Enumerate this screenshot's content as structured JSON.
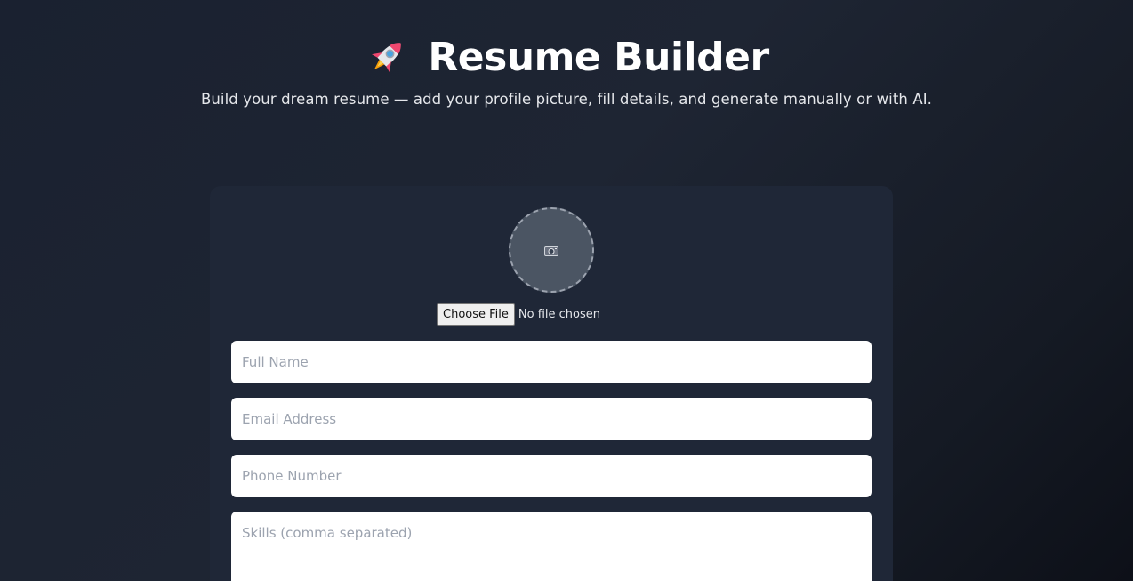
{
  "header": {
    "icon": "rocket-icon",
    "title": "Resume Builder",
    "subtitle": "Build your dream resume — add your profile picture, fill details, and generate manually or with AI."
  },
  "profile": {
    "avatar_icon": "camera-icon",
    "file_button_label": "Choose File",
    "file_status": "No file chosen"
  },
  "form": {
    "full_name_placeholder": "Full Name",
    "email_placeholder": "Email Address",
    "phone_placeholder": "Phone Number",
    "skills_placeholder": "Skills (comma separated)"
  },
  "colors": {
    "background": "#1e2533",
    "card": "#1f2737",
    "avatar": "#4b5563",
    "placeholder": "#9ca3af"
  }
}
